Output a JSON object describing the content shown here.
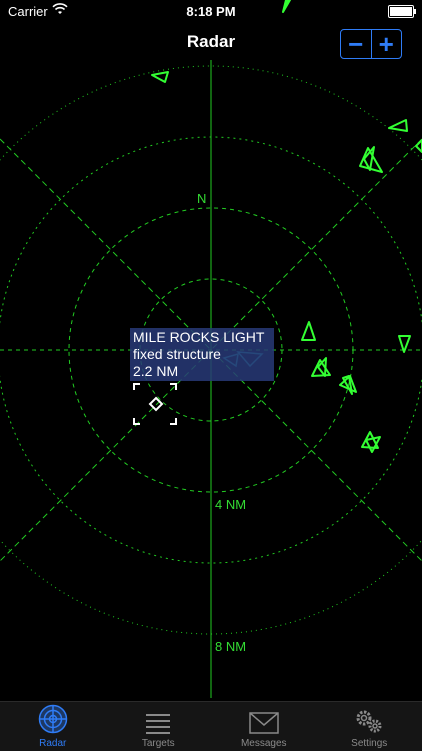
{
  "status_bar": {
    "carrier": "Carrier",
    "time": "8:18 PM"
  },
  "nav": {
    "title": "Radar",
    "zoom_out_label": "−",
    "zoom_in_label": "+"
  },
  "radar": {
    "north_label": "N",
    "ring_labels": [
      "4 NM",
      "8 NM"
    ],
    "grid_color": "#22cc22",
    "target_color": "#33ff33",
    "selected_target": {
      "name": "MILE ROCKS LIGHT",
      "type": "fixed structure",
      "range": "2.2 NM"
    }
  },
  "tabs": [
    {
      "label": "Radar",
      "icon": "radar-icon",
      "active": true
    },
    {
      "label": "Targets",
      "icon": "list-icon",
      "active": false
    },
    {
      "label": "Messages",
      "icon": "envelope-icon",
      "active": false
    },
    {
      "label": "Settings",
      "icon": "gears-icon",
      "active": false
    }
  ]
}
